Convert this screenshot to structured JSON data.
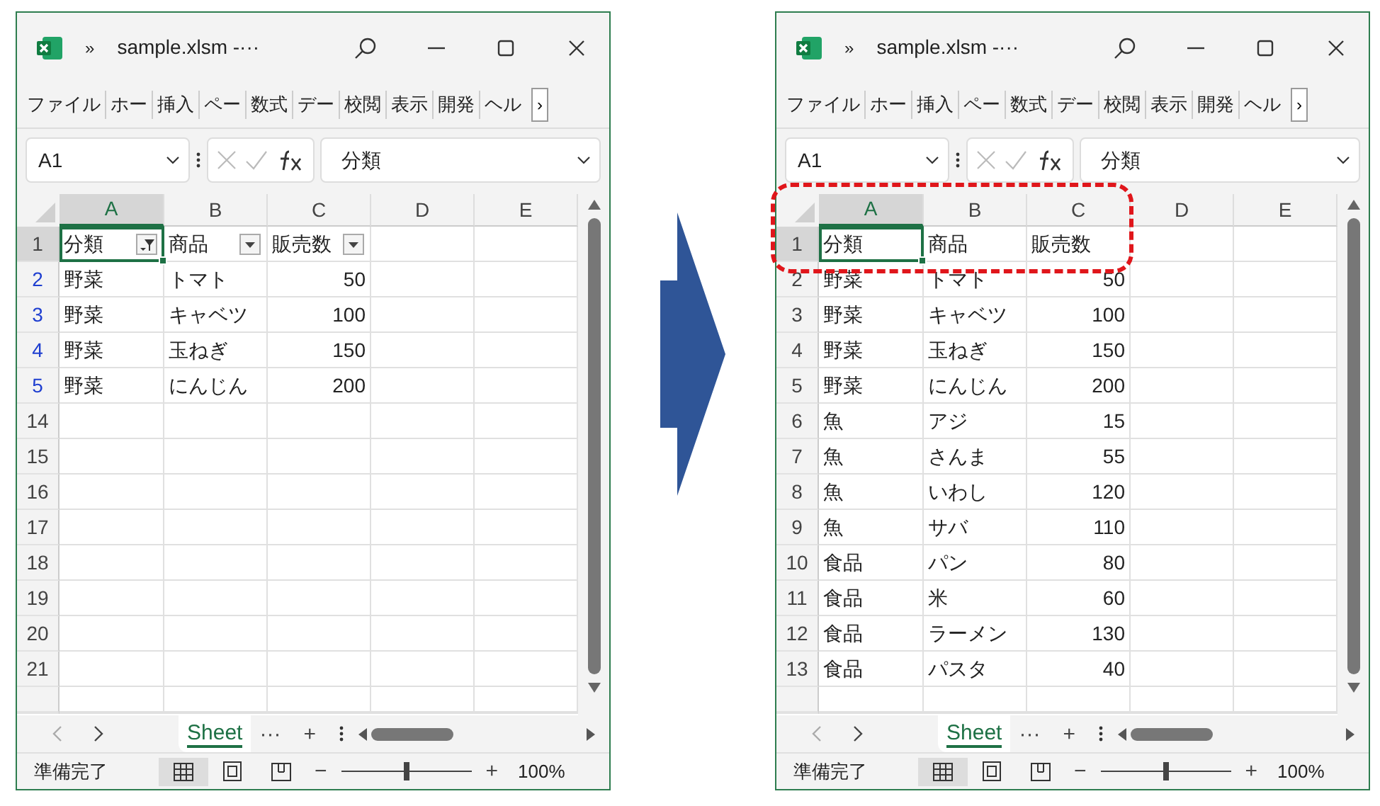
{
  "windows": [
    {
      "title": "sample.xlsm -···",
      "overflow": "»",
      "ribbon_tabs": [
        "ファイル",
        "ホー",
        "挿入",
        "ペー",
        "数式",
        "デー",
        "校閲",
        "表示",
        "開発",
        "ヘル"
      ],
      "ribbon_more": "›",
      "name_box": "A1",
      "formula": "分類",
      "columns": [
        {
          "label": "A",
          "selected": true
        },
        {
          "label": "B",
          "selected": false
        },
        {
          "label": "C",
          "selected": false
        },
        {
          "label": "D",
          "selected": false
        },
        {
          "label": "E",
          "selected": false
        }
      ],
      "filter_buttons": [
        {
          "kind": "applied"
        },
        {
          "kind": "dropdown"
        },
        {
          "kind": "dropdown"
        }
      ],
      "highlight": false,
      "rows": [
        {
          "number": "1",
          "kind": "header",
          "filtered": false,
          "selected": true,
          "cells": [
            "分類",
            "商品",
            "販売数"
          ]
        },
        {
          "number": "2",
          "kind": "data",
          "filtered": true,
          "selected": false,
          "cells": [
            "野菜",
            "トマト",
            "50"
          ]
        },
        {
          "number": "3",
          "kind": "data",
          "filtered": true,
          "selected": false,
          "cells": [
            "野菜",
            "キャベツ",
            "100"
          ]
        },
        {
          "number": "4",
          "kind": "data",
          "filtered": true,
          "selected": false,
          "cells": [
            "野菜",
            "玉ねぎ",
            "150"
          ]
        },
        {
          "number": "5",
          "kind": "data",
          "filtered": true,
          "selected": false,
          "cells": [
            "野菜",
            "にんじん",
            "200"
          ]
        },
        {
          "number": "14",
          "kind": "data",
          "filtered": false,
          "selected": false,
          "cells": []
        },
        {
          "number": "15",
          "kind": "data",
          "filtered": false,
          "selected": false,
          "cells": []
        },
        {
          "number": "16",
          "kind": "data",
          "filtered": false,
          "selected": false,
          "cells": []
        },
        {
          "number": "17",
          "kind": "data",
          "filtered": false,
          "selected": false,
          "cells": []
        },
        {
          "number": "18",
          "kind": "data",
          "filtered": false,
          "selected": false,
          "cells": []
        },
        {
          "number": "19",
          "kind": "data",
          "filtered": false,
          "selected": false,
          "cells": []
        },
        {
          "number": "20",
          "kind": "data",
          "filtered": false,
          "selected": false,
          "cells": []
        },
        {
          "number": "21",
          "kind": "data",
          "filtered": false,
          "selected": false,
          "cells": []
        }
      ],
      "sheet_tab": "Sheet",
      "sheet_more": "···",
      "sheet_add": "+",
      "status": "準備完了",
      "zoom_minus": "−",
      "zoom_plus": "+",
      "zoom_slider": {
        "level": 0.5
      },
      "zoom": "100%"
    },
    {
      "title": "sample.xlsm -···",
      "overflow": "»",
      "ribbon_tabs": [
        "ファイル",
        "ホー",
        "挿入",
        "ペー",
        "数式",
        "デー",
        "校閲",
        "表示",
        "開発",
        "ヘル"
      ],
      "ribbon_more": "›",
      "name_box": "A1",
      "formula": "分類",
      "columns": [
        {
          "label": "A",
          "selected": true
        },
        {
          "label": "B",
          "selected": false
        },
        {
          "label": "C",
          "selected": false
        },
        {
          "label": "D",
          "selected": false
        },
        {
          "label": "E",
          "selected": false
        }
      ],
      "highlight": true,
      "rows": [
        {
          "number": "1",
          "kind": "header",
          "filtered": false,
          "selected": true,
          "cells": [
            "分類",
            "商品",
            "販売数"
          ]
        },
        {
          "number": "2",
          "kind": "data",
          "filtered": false,
          "selected": false,
          "cells": [
            "野菜",
            "トマト",
            "50"
          ]
        },
        {
          "number": "3",
          "kind": "data",
          "filtered": false,
          "selected": false,
          "cells": [
            "野菜",
            "キャベツ",
            "100"
          ]
        },
        {
          "number": "4",
          "kind": "data",
          "filtered": false,
          "selected": false,
          "cells": [
            "野菜",
            "玉ねぎ",
            "150"
          ]
        },
        {
          "number": "5",
          "kind": "data",
          "filtered": false,
          "selected": false,
          "cells": [
            "野菜",
            "にんじん",
            "200"
          ]
        },
        {
          "number": "6",
          "kind": "data",
          "filtered": false,
          "selected": false,
          "cells": [
            "魚",
            "アジ",
            "15"
          ]
        },
        {
          "number": "7",
          "kind": "data",
          "filtered": false,
          "selected": false,
          "cells": [
            "魚",
            "さんま",
            "55"
          ]
        },
        {
          "number": "8",
          "kind": "data",
          "filtered": false,
          "selected": false,
          "cells": [
            "魚",
            "いわし",
            "120"
          ]
        },
        {
          "number": "9",
          "kind": "data",
          "filtered": false,
          "selected": false,
          "cells": [
            "魚",
            "サバ",
            "110"
          ]
        },
        {
          "number": "10",
          "kind": "data",
          "filtered": false,
          "selected": false,
          "cells": [
            "食品",
            "パン",
            "80"
          ]
        },
        {
          "number": "11",
          "kind": "data",
          "filtered": false,
          "selected": false,
          "cells": [
            "食品",
            "米",
            "60"
          ]
        },
        {
          "number": "12",
          "kind": "data",
          "filtered": false,
          "selected": false,
          "cells": [
            "食品",
            "ラーメン",
            "130"
          ]
        },
        {
          "number": "13",
          "kind": "data",
          "filtered": false,
          "selected": false,
          "cells": [
            "食品",
            "パスタ",
            "40"
          ]
        }
      ],
      "sheet_tab": "Sheet",
      "sheet_more": "···",
      "sheet_add": "+",
      "status": "準備完了",
      "zoom_minus": "−",
      "zoom_plus": "+",
      "zoom_slider": {
        "level": 0.5
      },
      "zoom": "100%"
    }
  ]
}
